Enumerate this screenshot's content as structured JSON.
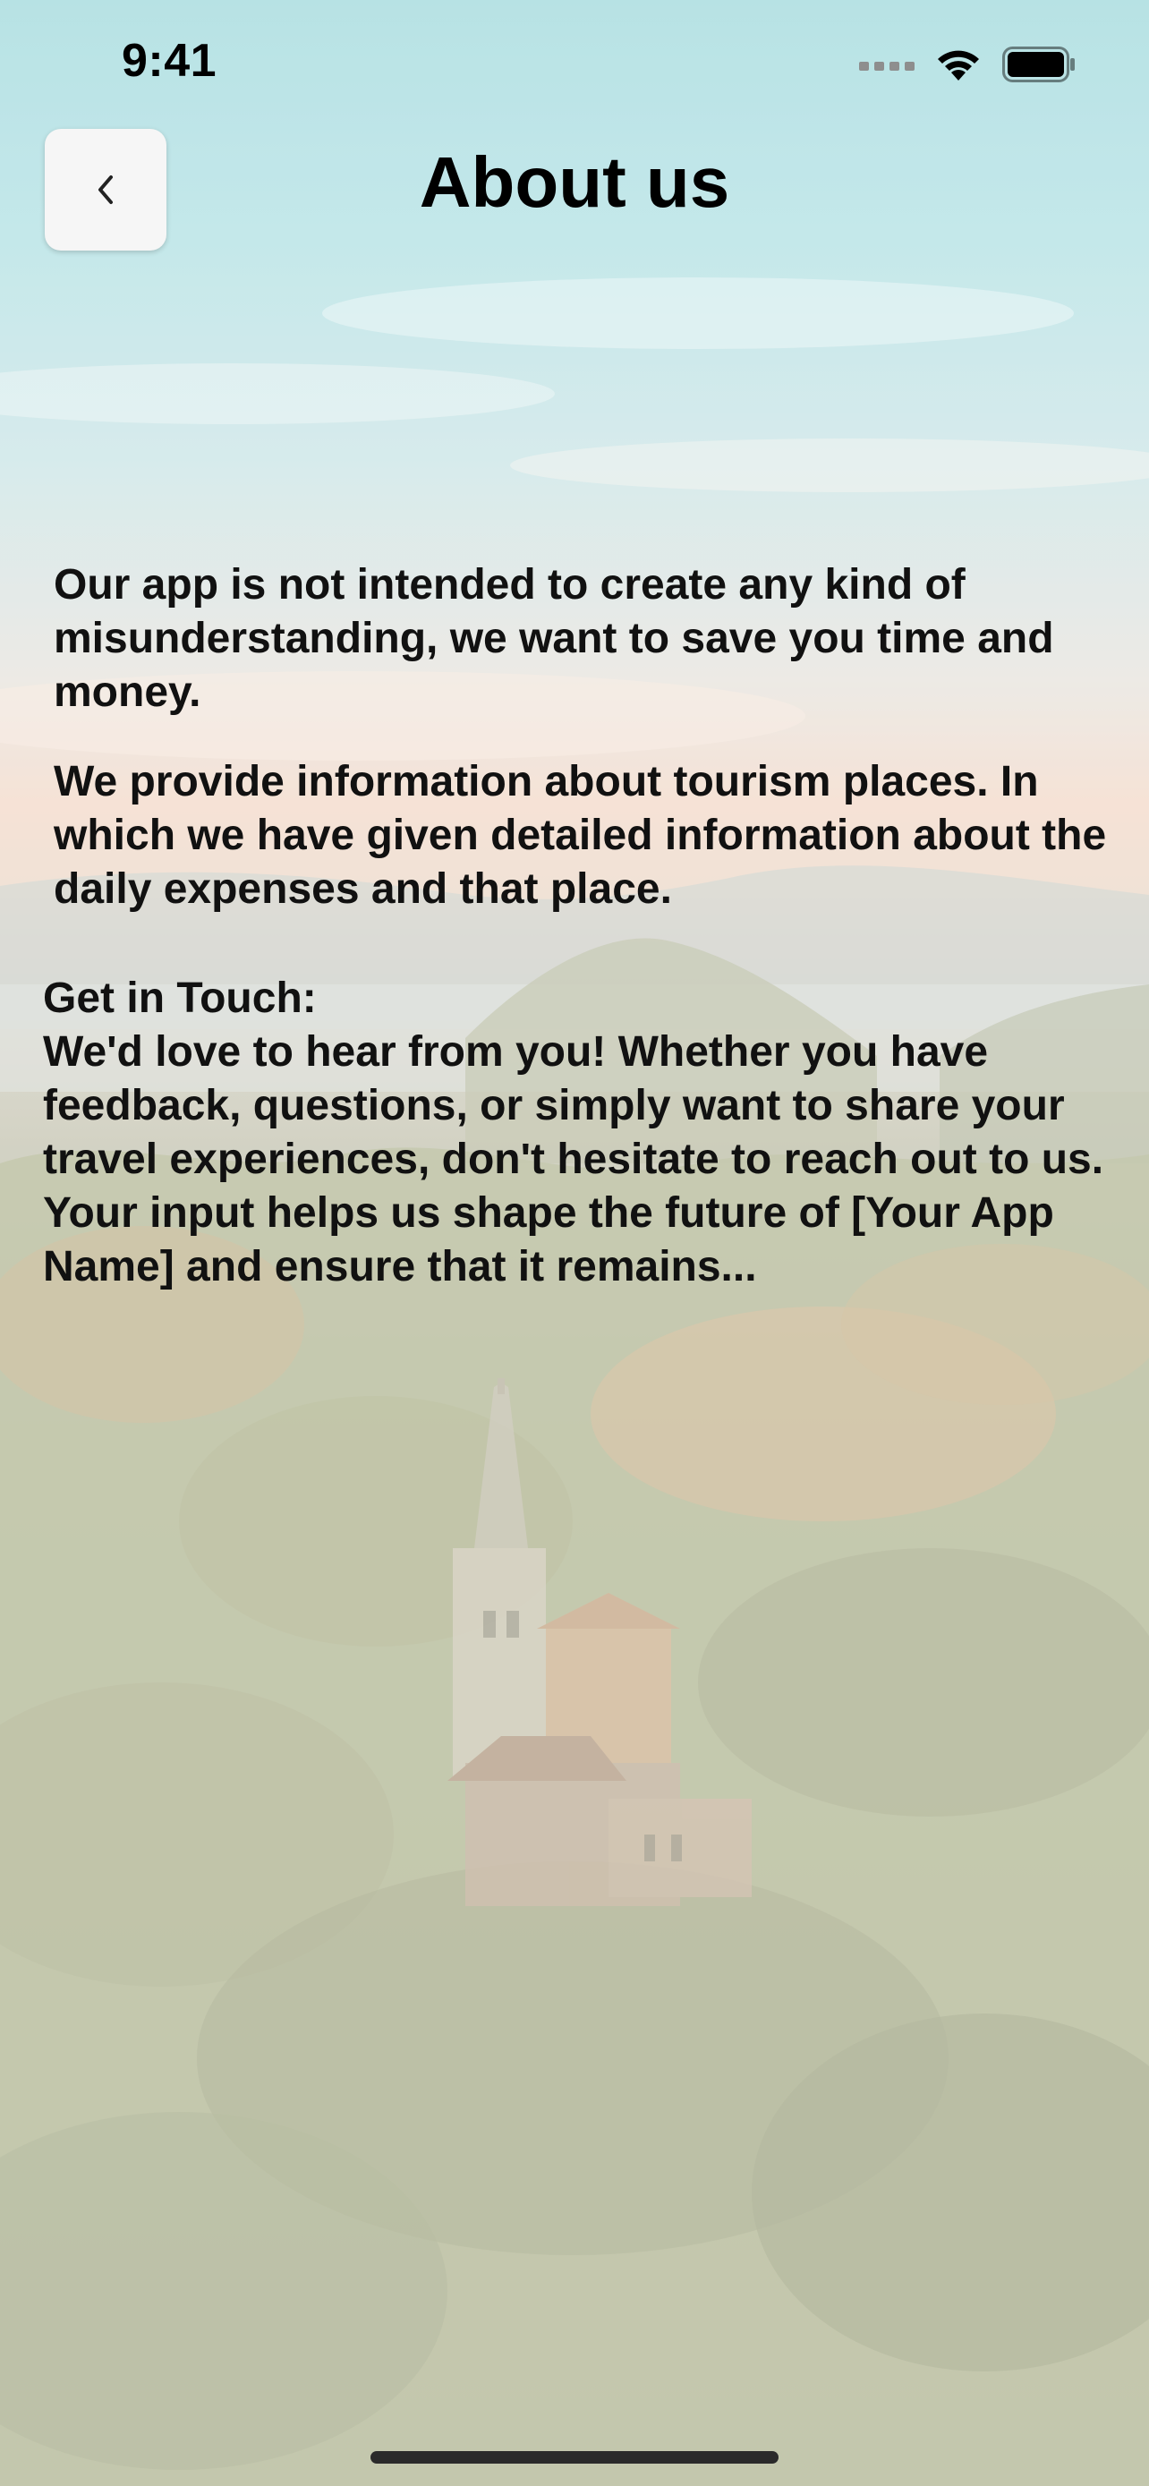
{
  "status_bar": {
    "time": "9:41"
  },
  "header": {
    "title": "About us",
    "back_icon": "chevron-left-icon"
  },
  "content": {
    "paragraph_1": "Our app is not intended to create any kind of misunderstanding, we want to save you time and money.",
    "paragraph_2": "We provide information about tourism places. In which we have given detailed information about the daily expenses and that place.",
    "contact": {
      "heading": "Get in Touch:",
      "text": "We'd love to hear from you! Whether you have feedback, questions, or simply want to share your travel experiences, don't hesitate to reach out to us. Your input helps us shape the future of [Your App Name] and ensure that it remains..."
    }
  },
  "colors": {
    "sky": "#b7e3e6",
    "sunset": "#f4dccd",
    "forest": "#b4b99e",
    "text": "#111111",
    "button_bg": "#f6f6f6"
  }
}
